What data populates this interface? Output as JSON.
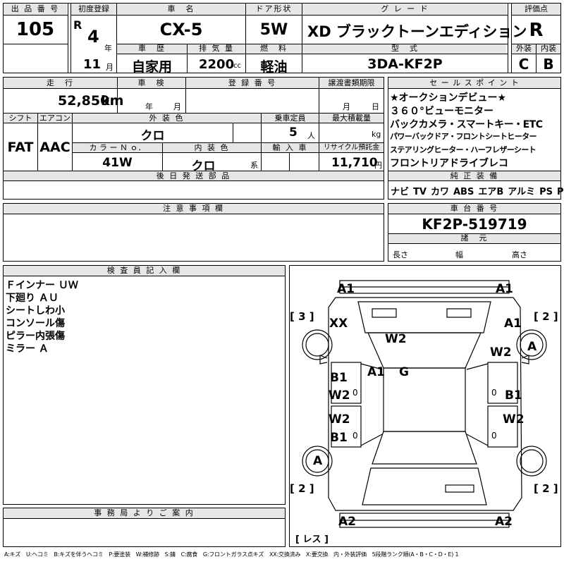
{
  "header": {
    "lot_label": "出 品 番 号",
    "lot_number": "105",
    "first_reg_label": "初度登録",
    "era_letter": "R",
    "year_value": "4",
    "year_unit": "年",
    "month_value": "11",
    "month_unit": "月",
    "car_name_label": "車　名",
    "car_name": "CX-5",
    "history_label": "車　歴",
    "history_value": "自家用",
    "displacement_label": "排 気 量",
    "displacement_value": "2200",
    "displacement_unit": "cc",
    "door_label": "ドア形状",
    "door_value": "5W",
    "fuel_label": "燃　料",
    "fuel_value": "軽油",
    "grade_label": "グ レ ー ド",
    "grade_value": "XD ブラックトーンエディション",
    "model_label": "型　式",
    "model_value": "3DA-KF2P",
    "score_label": "評価点",
    "score_value": "R",
    "exterior_label": "外装",
    "exterior_value": "C",
    "interior_label": "内装",
    "interior_value": "B"
  },
  "details": {
    "mileage_label": "走　行",
    "mileage_value": "52,850",
    "mileage_unit": "km",
    "inspection_label": "車　検",
    "inspection_year_unit": "年",
    "inspection_month_unit": "月",
    "reg_number_label": "登 録 番 号",
    "transfer_label": "譲渡書類期限",
    "transfer_month_unit": "月",
    "transfer_day_unit": "日",
    "shift_label": "シフト",
    "shift_value": "FAT",
    "ac_label": "エアコン",
    "ac_value": "AAC",
    "exterior_color_label": "外 装 色",
    "exterior_color_value": "クロ",
    "capacity_label": "乗車定員",
    "capacity_value": "5",
    "capacity_unit": "人",
    "max_load_label": "最大積載量",
    "max_load_unit": "kg",
    "color_no_label": "カ ラ ー Ｎ ｏ．",
    "color_no_value": "41W",
    "interior_color_label": "内 装 色",
    "interior_color_value": "クロ",
    "interior_color_unit": "系",
    "import_label": "輸 入 車",
    "recycle_label": "リサイクル預託金",
    "recycle_value": "11,710",
    "recycle_unit": "円",
    "later_parts_label": "後 日 発 送 部 品"
  },
  "sales_points": {
    "label": "セ ー ル ス ポ イ ン ト",
    "lines": [
      "★オークションデビュー★",
      "３６０°ビューモニター",
      "バックカメラ・スマートキー・ETC",
      "パワーバックドア・フロントシートヒーター",
      "ステアリングヒーター・ハーフレザーシート",
      "フロントリアドライブレコ"
    ]
  },
  "equipment": {
    "label": "純 正 装 備",
    "items": [
      "ナビ",
      "TV",
      "カワ",
      "ABS",
      "エアB",
      "アルミ",
      "PS",
      "PW"
    ]
  },
  "notes": {
    "label": "注 意 事 項 欄"
  },
  "chassis": {
    "label": "車 台 番 号",
    "value": "KF2P-519719",
    "dims_label": "諸　元",
    "length_label": "長さ",
    "width_label": "幅",
    "height_label": "高さ"
  },
  "inspector": {
    "label": "検 査 員 記 入 欄",
    "lines": [
      "Ｆインナー ＵＷ",
      "下廻り ＡＵ",
      "シートしわ小",
      "コンソール傷",
      "ピラー内張傷",
      "ミラー Ａ"
    ]
  },
  "office": {
    "label": "事 務 局 よ り ご 案 内"
  },
  "diagram": {
    "marks": {
      "front_left_a1": "A1",
      "front_right_a1": "A1",
      "count_left_top": "[ 3 ]",
      "count_right_top": "[ 2 ]",
      "xx": "XX",
      "right_fender_a1": "A1",
      "hood_w2": "W2",
      "right_w2_upper": "W2",
      "right_front_wheel": "A",
      "left_door_b1": "B1",
      "windshield_a1": "A1",
      "roof_g": "G",
      "left_door_w2": "W2",
      "right_door_b1": "B1",
      "left_rear_w2": "W2",
      "right_rear_w2": "W2",
      "left_rear_b1": "B1",
      "left_rear_wheel": "A",
      "count_left_bottom": "[ 2 ]",
      "count_right_bottom": "[ 2 ]",
      "rear_left_a2": "A2",
      "rear_right_a2": "A2",
      "rearless": "[ レス ]"
    }
  },
  "legend": "A:キズ　U:ヘコミ　B:キズを伴うヘコミ　P:要塗装　W:補修跡　S:錆　C:腐食　G:フロントガラス点キズ　XX:交換済み　X:要交換　内・外装評価　5段階ランク順(A・B・C・D・E) 1"
}
